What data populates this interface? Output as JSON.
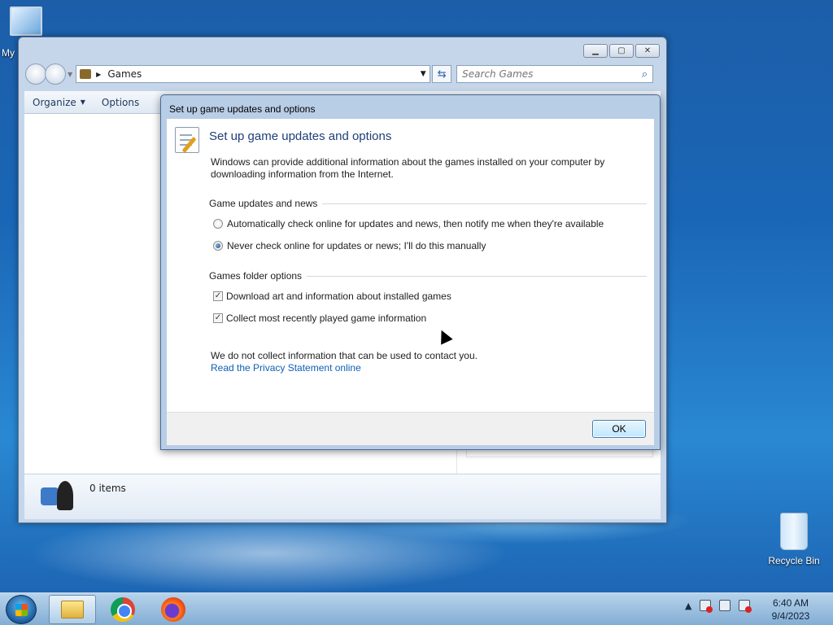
{
  "desktop": {
    "icons": [
      {
        "label": "My"
      },
      {
        "label": "Recycle Bin"
      }
    ]
  },
  "explorer": {
    "address": "Games",
    "search_placeholder": "Search Games",
    "toolbar": {
      "organize": "Organize",
      "options": "Options"
    },
    "details": {
      "count": "0 items"
    }
  },
  "dialog": {
    "title": "Set up game updates and options",
    "heading": "Set up game updates and options",
    "description": "Windows can provide additional information about the games installed on your computer by downloading information from the Internet.",
    "updates_group": {
      "label": "Game updates and news",
      "options": [
        {
          "label": "Automatically check online for updates and news, then notify me when they're available",
          "selected": false
        },
        {
          "label": "Never check online for updates or news; I'll do this manually",
          "selected": true
        }
      ]
    },
    "folder_group": {
      "label": "Games folder options",
      "options": [
        {
          "label": "Download art and information about installed games",
          "checked": true
        },
        {
          "label": "Collect most recently played game information",
          "checked": true
        }
      ]
    },
    "privacy_note": "We do not collect information that can be used to contact you.",
    "privacy_link": "Read the Privacy Statement online",
    "ok_label": "OK"
  },
  "taskbar": {
    "apps": [
      "explorer",
      "chrome",
      "firefox"
    ],
    "clock": {
      "time": "6:40 AM",
      "date": "9/4/2023"
    }
  }
}
